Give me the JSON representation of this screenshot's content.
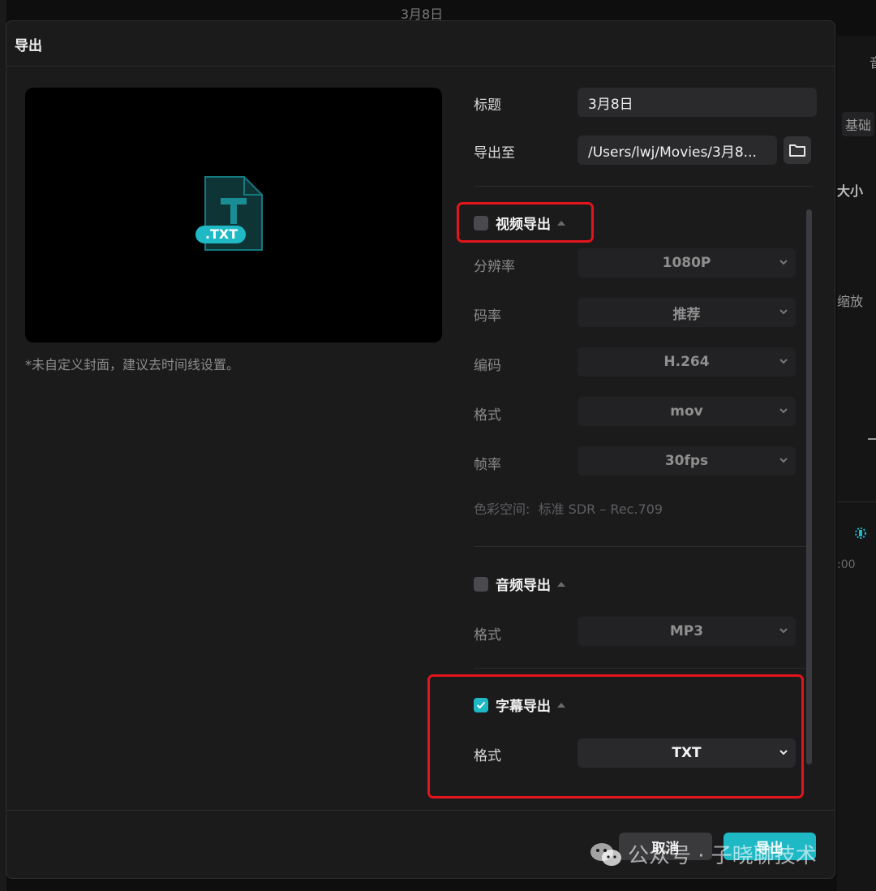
{
  "background_app": {
    "window_title": "3月8日",
    "right_panel": {
      "tab_partial": "音",
      "basic_button": "基础",
      "size_label": "大小",
      "zoom_label": "缩放",
      "timecode_partial": ":00"
    }
  },
  "dialog": {
    "title": "导出",
    "preview": {
      "file_badge": ".TXT",
      "note": "*未自定义封面，建议去时间线设置。"
    },
    "title_field": {
      "label": "标题",
      "value": "3月8日"
    },
    "export_to": {
      "label": "导出至",
      "value": "/Users/lwj/Movies/3月8...",
      "folder_icon": "folder-icon"
    },
    "video_export": {
      "label": "视频导出",
      "checked": false,
      "resolution": {
        "label": "分辨率",
        "value": "1080P"
      },
      "bitrate": {
        "label": "码率",
        "value": "推荐"
      },
      "codec": {
        "label": "编码",
        "value": "H.264"
      },
      "format": {
        "label": "格式",
        "value": "mov"
      },
      "framerate": {
        "label": "帧率",
        "value": "30fps"
      },
      "colorspace_label": "色彩空间:",
      "colorspace_value": "标准 SDR – Rec.709"
    },
    "audio_export": {
      "label": "音频导出",
      "checked": false,
      "format": {
        "label": "格式",
        "value": "MP3"
      }
    },
    "subtitle_export": {
      "label": "字幕导出",
      "checked": true,
      "format": {
        "label": "格式",
        "value": "TXT"
      }
    },
    "buttons": {
      "cancel": "取消",
      "export": "导出"
    }
  },
  "watermark": {
    "text": "公众号 · 子晓聊技术"
  },
  "colors": {
    "accent": "#1fb9c5",
    "highlight": "#e3141b",
    "dialog_bg": "#1b1b1c"
  }
}
